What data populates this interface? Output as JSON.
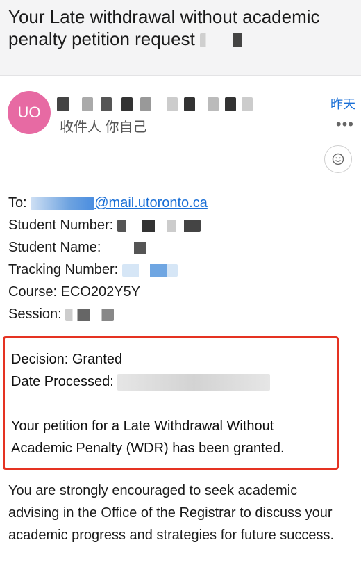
{
  "subject": "Your Late withdrawal without academic penalty petition request",
  "avatar_initials": "UO",
  "recipient_label": "收件人 你自己",
  "date_label": "昨天",
  "more_label": "•••",
  "fields": {
    "to_label": "To:",
    "email_domain": "@mail.utoronto.ca",
    "student_number_label": "Student Number:",
    "student_name_label": "Student Name:",
    "tracking_label": "Tracking Number:",
    "course_line": "Course: ECO202Y5Y",
    "session_label": "Session:"
  },
  "decision": {
    "decision_line": "Decision: Granted",
    "date_processed_label": "Date Processed:",
    "petition_message": "Your petition for a Late Withdrawal Without Academic Penalty (WDR) has been granted."
  },
  "advice_paragraph": "You are strongly encouraged to seek academic advising in the Office of the Registrar to discuss your academic progress and strategies for future success.",
  "colors": {
    "accent_link": "#1a6fd6",
    "avatar": "#e76aa3",
    "highlight_box": "#e53222"
  },
  "icons": [
    "emoji-smile-icon",
    "more-horizontal-icon"
  ]
}
